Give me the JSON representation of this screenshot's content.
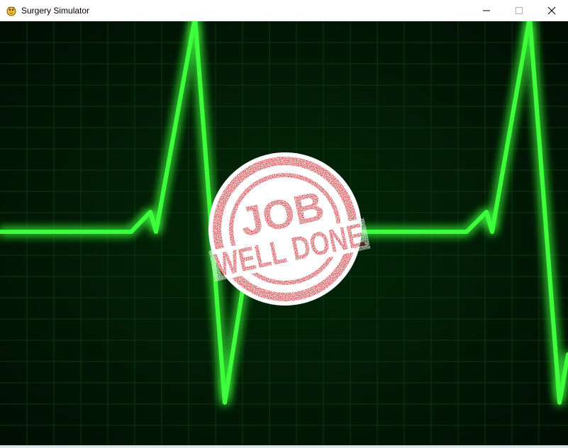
{
  "window": {
    "title": "Surgery Simulator",
    "controls": {
      "minimize": "minimize-icon",
      "maximize": "maximize-icon",
      "close": "close-icon"
    }
  },
  "scene": {
    "background_color": "#021a05",
    "grid_color": "#0d3a12",
    "trace_color": "#3dff3a",
    "trace_glow_color": "#1fbf1c",
    "stamp_color": "#c8262c",
    "stamp": {
      "line1": "JOB",
      "line2": "WELL DONE"
    }
  }
}
